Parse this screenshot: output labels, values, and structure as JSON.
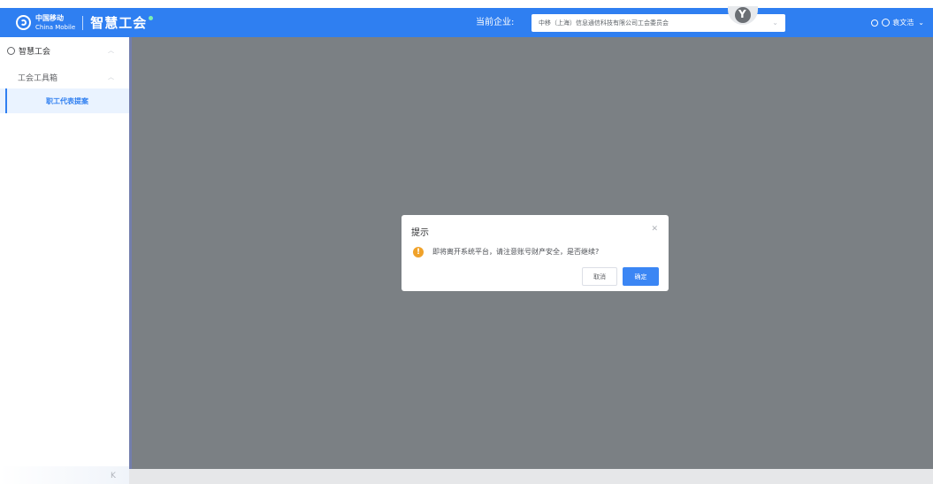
{
  "header": {
    "brand_line1": "中国移动",
    "brand_line2": "China Mobile",
    "product": "智慧工会",
    "company_label": "当前企业:",
    "company_value": "中移（上海）信息通信科技有限公司工会委员会",
    "user_name": "袁文浩"
  },
  "sidebar": {
    "root": "智慧工会",
    "group": "工会工具箱",
    "active_item": "职工代表提案"
  },
  "dialog": {
    "title": "提示",
    "message": "即将离开系统平台，请注意账号财产安全，是否继续?",
    "cancel": "取消",
    "confirm": "确定"
  },
  "colors": {
    "header": "#2f7ff1",
    "overlay": "#7b8084",
    "warning": "#f0a22a",
    "primary_button": "#3b86f4"
  }
}
